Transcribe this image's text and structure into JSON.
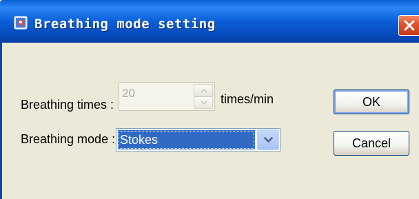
{
  "window": {
    "title": "Breathing mode setting"
  },
  "form": {
    "breathing_times_label": "Breathing times :",
    "breathing_times_value": "20",
    "breathing_times_unit": "times/min",
    "breathing_mode_label": "Breathing mode :",
    "breathing_mode_selected": "Stokes"
  },
  "buttons": {
    "ok_label": "OK",
    "cancel_label": "Cancel"
  },
  "icons": {
    "app": "app-icon",
    "close": "close-icon",
    "spin_up": "arrow-up-icon",
    "spin_down": "arrow-down-icon",
    "dropdown": "chevron-down-icon"
  },
  "colors": {
    "title_bar": "#0a5fd8",
    "selection": "#316ac5",
    "close_button": "#e3552e"
  }
}
